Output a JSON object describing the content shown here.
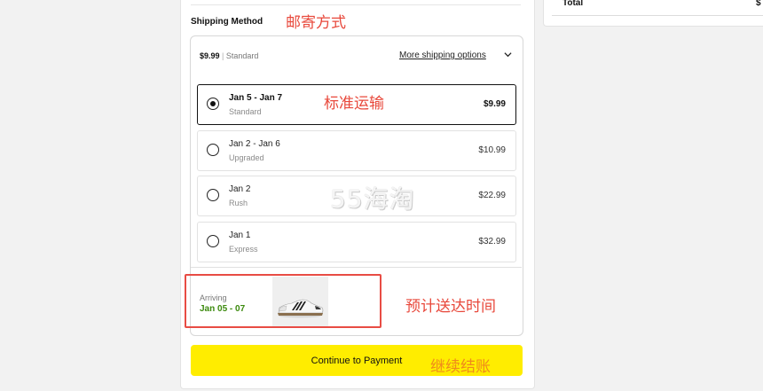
{
  "summary": {
    "total_label": "Total",
    "total_value": "$"
  },
  "shipping": {
    "section_title": "Shipping Method",
    "summary_price": "$9.99",
    "summary_separator": "|",
    "summary_method": "Standard",
    "more_options_label": "More shipping options",
    "options": [
      {
        "dates": "Jan 5 - Jan 7",
        "type": "Standard",
        "price": "$9.99",
        "selected": true
      },
      {
        "dates": "Jan 2 - Jan 6",
        "type": "Upgraded",
        "price": "$10.99",
        "selected": false
      },
      {
        "dates": "Jan 2",
        "type": "Rush",
        "price": "$22.99",
        "selected": false
      },
      {
        "dates": "Jan 1",
        "type": "Express",
        "price": "$32.99",
        "selected": false
      }
    ]
  },
  "arrival": {
    "label": "Arriving",
    "dates": "Jan 05 - 07"
  },
  "cta": {
    "label": "Continue to Payment"
  },
  "annotations": {
    "shipping_method": "邮寄方式",
    "standard_shipping": "标准运输",
    "estimated_delivery": "预计送达时间",
    "continue_checkout": "继续结账"
  },
  "watermark": "55海淘",
  "colors": {
    "cta": "#ffed00",
    "arrival_date": "#3c8a0e",
    "annotation": "#e8483b",
    "annotation_cta": "#f08a1c",
    "highlight_border": "#e84c44"
  }
}
